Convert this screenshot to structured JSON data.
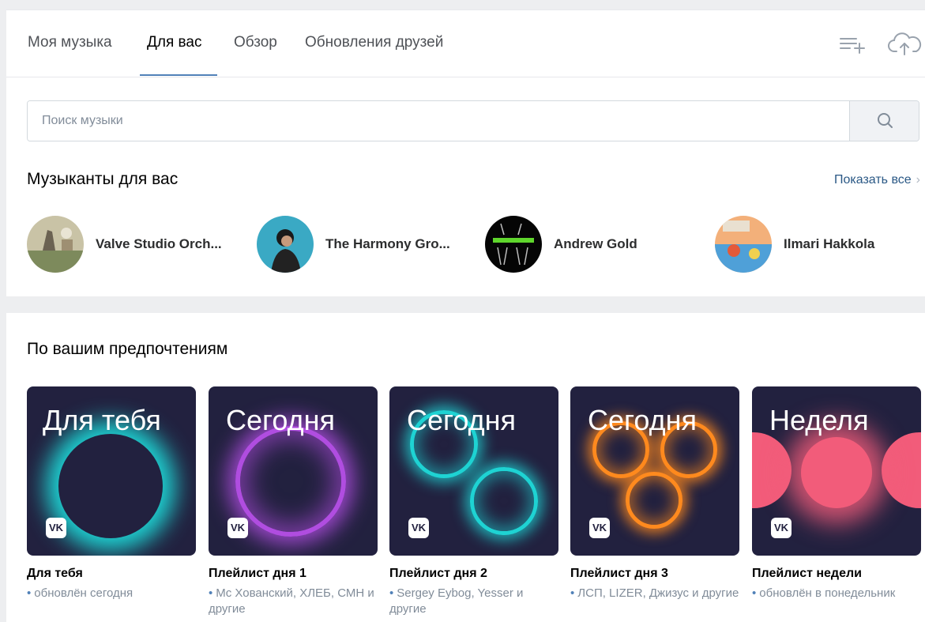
{
  "tabs": [
    {
      "label": "Моя музыка"
    },
    {
      "label": "Для вас",
      "active": true
    },
    {
      "label": "Обзор"
    },
    {
      "label": "Обновления друзей"
    }
  ],
  "icons": {
    "add_playlist": "add-playlist-icon",
    "upload": "cloud-upload-icon",
    "search": "search-icon"
  },
  "search": {
    "placeholder": "Поиск музыки",
    "value": ""
  },
  "musicians": {
    "title": "Музыканты для вас",
    "show_all": "Показать все",
    "items": [
      {
        "name": "Valve Studio Orch..."
      },
      {
        "name": "The Harmony Gro..."
      },
      {
        "name": "Andrew Gold"
      },
      {
        "name": "Ilmari Hakkola"
      }
    ]
  },
  "preferences": {
    "title": "По вашим предпочтениям",
    "playlists": [
      {
        "cover_title": "Для тебя",
        "name": "Для тебя",
        "subtitle": "обновлён сегодня"
      },
      {
        "cover_title": "Сегодня",
        "name": "Плейлист дня 1",
        "subtitle": "Mc Хованский, ХЛЕБ, СМН и другие"
      },
      {
        "cover_title": "Сегодня",
        "name": "Плейлист дня 2",
        "subtitle": "Sergey Eybog, Yesser и другие"
      },
      {
        "cover_title": "Сегодня",
        "name": "Плейлист дня 3",
        "subtitle": "ЛСП, LIZER, Джизус и другие"
      },
      {
        "cover_title": "Неделя",
        "name": "Плейлист недели",
        "subtitle": "обновлён в понедельник"
      }
    ]
  },
  "colors": {
    "accent": "#5181b8",
    "link": "#2a5885",
    "cover_bg": "#22213f",
    "cyan_glow": "#1ed3d3",
    "purple_glow": "#b04de0",
    "orange_glow": "#ff8a1e",
    "pink": "#f25c7a"
  }
}
